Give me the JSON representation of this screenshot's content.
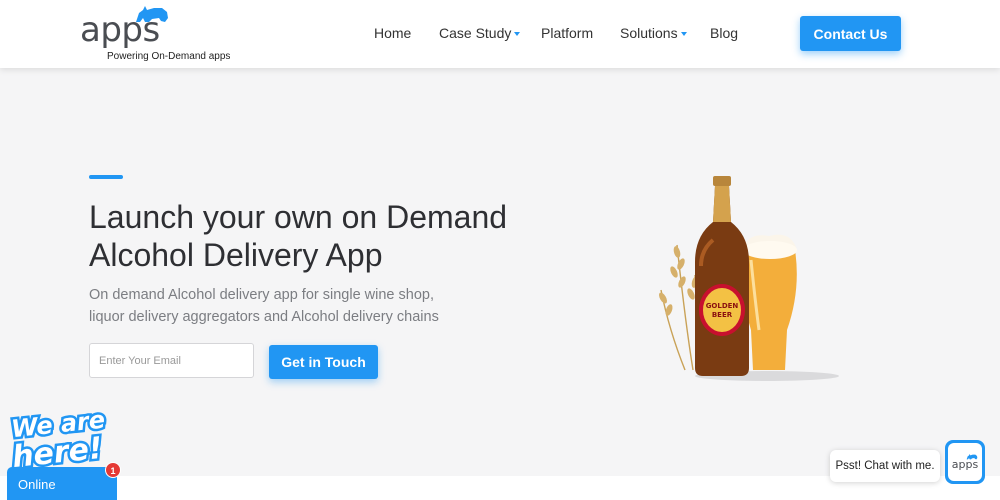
{
  "header": {
    "logo_text": "apps",
    "logo_tagline": "Powering On-Demand apps",
    "nav": [
      {
        "label": "Home",
        "has_dropdown": false
      },
      {
        "label": "Case Study",
        "has_dropdown": true
      },
      {
        "label": "Platform",
        "has_dropdown": false
      },
      {
        "label": "Solutions",
        "has_dropdown": true
      },
      {
        "label": "Blog",
        "has_dropdown": false
      }
    ],
    "contact_label": "Contact Us"
  },
  "hero": {
    "title_line1": "Launch your own on Demand",
    "title_line2": "Alcohol Delivery App",
    "subtitle_line1": "On demand Alcohol delivery app for single wine shop,",
    "subtitle_line2": "liquor delivery aggregators and Alcohol delivery chains",
    "email_placeholder": "Enter Your Email",
    "email_value": "",
    "cta_label": "Get in Touch",
    "image_icon": "beer-bottle-and-glass",
    "bottle_label_line1": "GOLDEN",
    "bottle_label_line2": "BEER"
  },
  "chat": {
    "we_are_here": "We are here!",
    "status": "Online",
    "unread_count": "1",
    "bubble_text": "Psst! Chat with me.",
    "launcher_logo": "apps"
  },
  "colors": {
    "accent": "#2196f3",
    "background": "#f5f5f6",
    "header_bg": "#ffffff",
    "title_text": "#2e2f33",
    "subtitle_text": "#7b7d82",
    "badge": "#e53935"
  }
}
